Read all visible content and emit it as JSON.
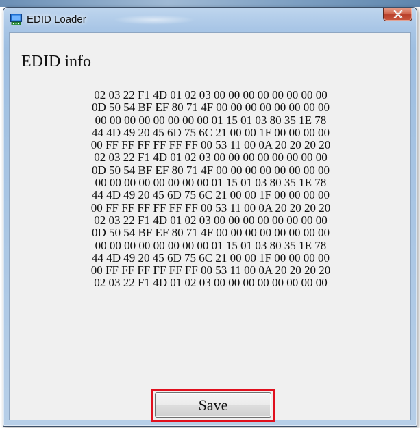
{
  "window": {
    "title": "EDID Loader",
    "icon": "monitor-app-icon",
    "close_icon": "close-icon"
  },
  "edid": {
    "heading": "EDID info",
    "lines": [
      "02 03 22 F1 4D 01 02 03 00 00 00 00 00 00 00 00",
      "0D 50 54 BF EF 80 71 4F 00 00 00 00 00 00 00 00",
      "00 00 00 00 00 00 00 00 01 15 01 03 80 35 1E 78",
      "44 4D 49 20 45 6D 75 6C 21 00 00 1F 00 00 00 00",
      "00 FF FF FF FF FF FF 00 53 11 00 0A 20 20 20 20",
      "02 03 22 F1 4D 01 02 03 00 00 00 00 00 00 00 00",
      "0D 50 54 BF EF 80 71 4F 00 00 00 00 00 00 00 00",
      "00 00 00 00 00 00 00 00 01 15 01 03 80 35 1E 78",
      "44 4D 49 20 45 6D 75 6C 21 00 00 1F 00 00 00 00",
      "00 FF FF FF FF FF FF 00 53 11 00 0A 20 20 20 20",
      "02 03 22 F1 4D 01 02 03 00 00 00 00 00 00 00 00",
      "0D 50 54 BF EF 80 71 4F 00 00 00 00 00 00 00 00",
      "00 00 00 00 00 00 00 00 01 15 01 03 80 35 1E 78",
      "44 4D 49 20 45 6D 75 6C 21 00 00 1F 00 00 00 00",
      "00 FF FF FF FF FF FF 00 53 11 00 0A 20 20 20 20",
      "02 03 22 F1 4D 01 02 03 00 00 00 00 00 00 00 00"
    ]
  },
  "actions": {
    "save_label": "Save"
  },
  "colors": {
    "highlight": "#e0101e",
    "close_button": "#c9573f",
    "client_background": "#f0f0f0"
  }
}
